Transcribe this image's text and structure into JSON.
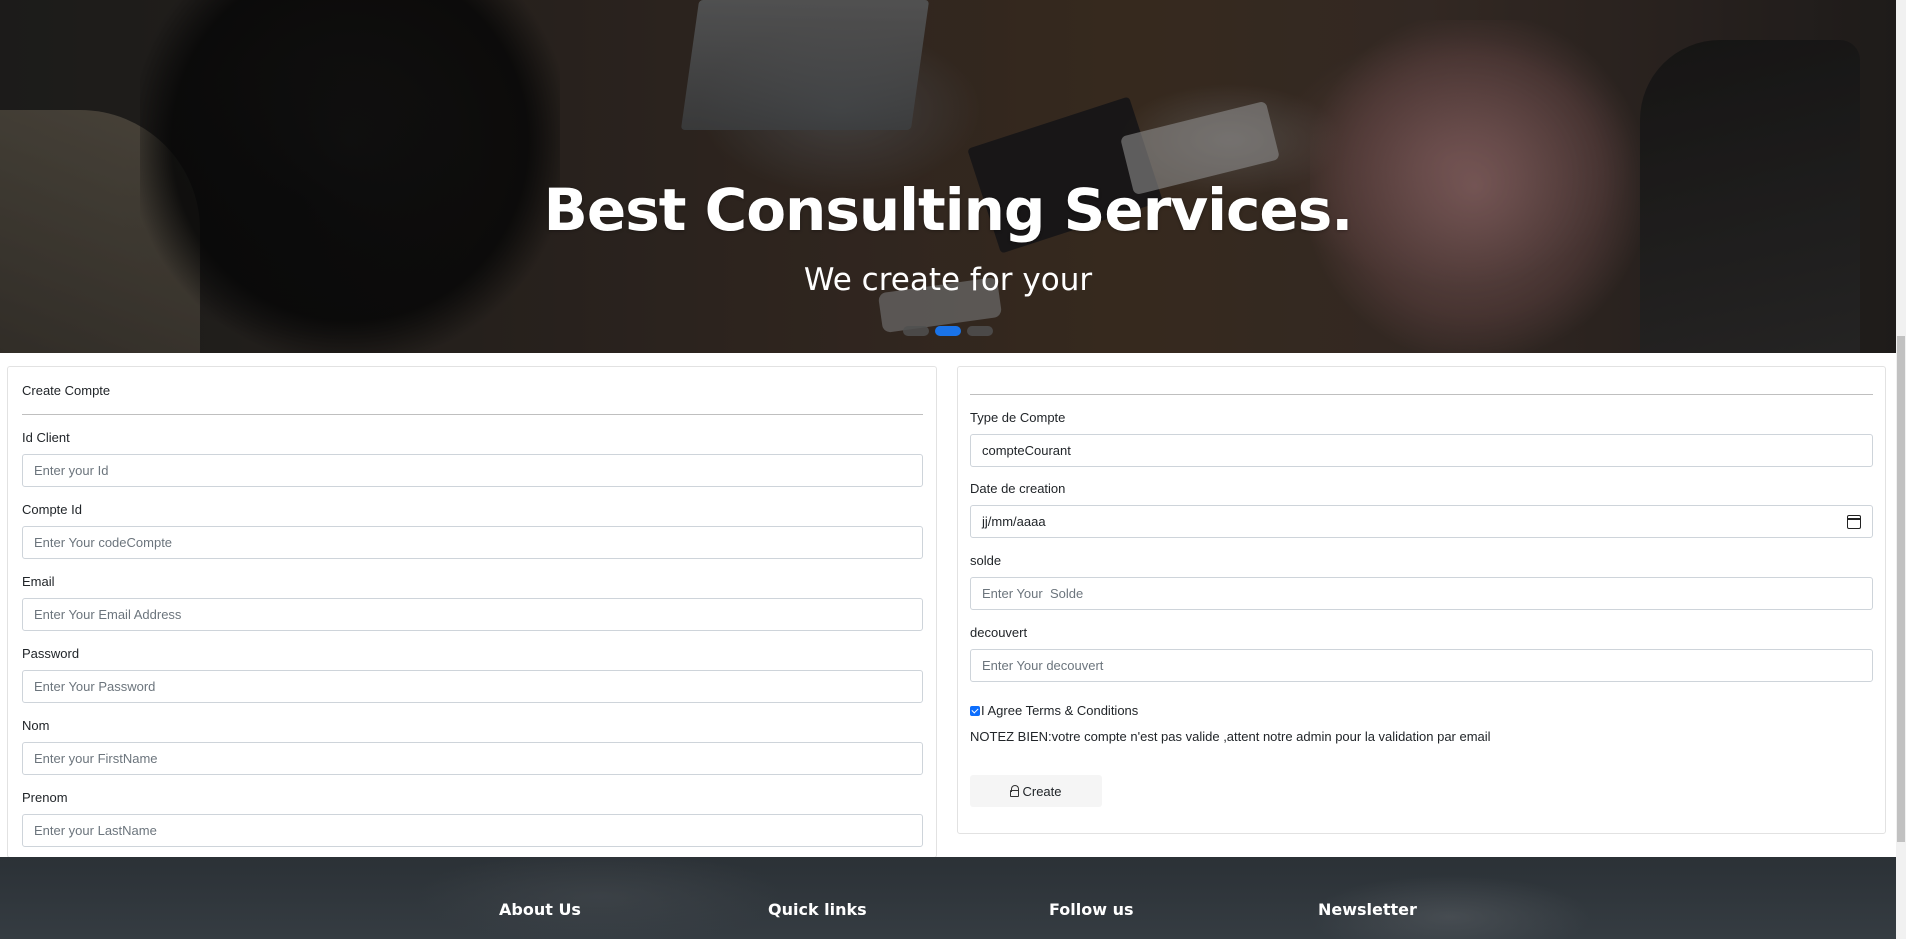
{
  "hero": {
    "title": "Best Consulting Services.",
    "subtitle": "We create for your",
    "slides": 3,
    "active_slide": 2
  },
  "left_form": {
    "title": "Create Compte",
    "fields": [
      {
        "label": "Id Client",
        "placeholder": "Enter your Id"
      },
      {
        "label": "Compte Id",
        "placeholder": "Enter Your codeCompte"
      },
      {
        "label": "Email",
        "placeholder": "Enter Your Email Address"
      },
      {
        "label": "Password",
        "placeholder": "Enter Your Password"
      },
      {
        "label": "Nom",
        "placeholder": "Enter your FirstName"
      },
      {
        "label": "Prenom",
        "placeholder": "Enter your LastName"
      }
    ]
  },
  "right_form": {
    "type_label": "Type de Compte",
    "type_value": "compteCourant",
    "date_label": "Date de creation",
    "date_value": "jj/mm/aaaa",
    "solde_label": "solde",
    "solde_placeholder": "Enter Your  Solde",
    "decouvert_label": "decouvert",
    "decouvert_placeholder": "Enter Your decouvert",
    "terms_label": "I Agree Terms & Conditions",
    "terms_checked": true,
    "notice": "NOTEZ BIEN:votre compte n'est pas valide ,attent notre admin pour la validation par email",
    "create_label": "Create"
  },
  "footer": {
    "headings": [
      "About Us",
      "Quick links",
      "Follow us",
      "Newsletter"
    ]
  },
  "colors": {
    "accent": "#0d6efd",
    "indicator_active": "#1a73e8",
    "footer_bg": "#2f363c"
  }
}
